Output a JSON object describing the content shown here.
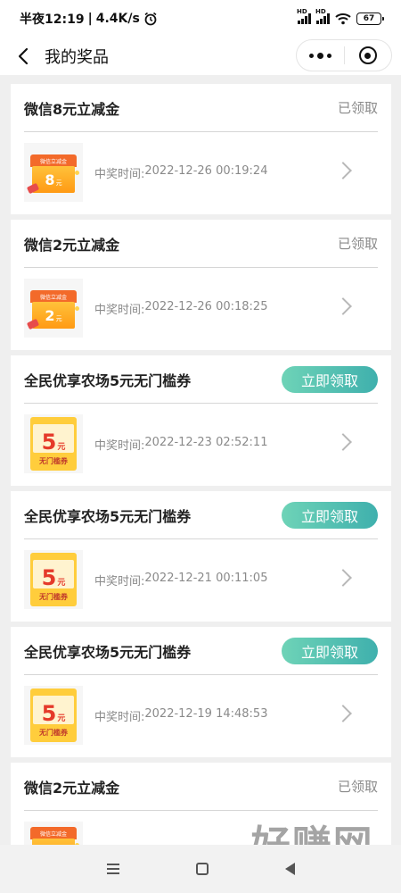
{
  "status_bar": {
    "time": "半夜12:19",
    "speed": "4.4K/s",
    "battery": "67"
  },
  "nav": {
    "title": "我的奖品"
  },
  "labels": {
    "win_time_prefix": "中奖时间:",
    "claimed": "已领取",
    "claim_now": "立即领取"
  },
  "prizes": [
    {
      "title": "微信8元立减金",
      "status": "已领取",
      "time": "2022-12-26 00:19:24",
      "thumb_value": "8",
      "thumb_unit": "元",
      "thumb_label": "微信立减金"
    },
    {
      "title": "微信2元立减金",
      "status": "已领取",
      "time": "2022-12-26 00:18:25",
      "thumb_value": "2",
      "thumb_unit": "元",
      "thumb_label": "微信立减金"
    },
    {
      "title": "全民优享农场5元无门槛券",
      "status": "立即领取",
      "time": "2022-12-23 02:52:11",
      "thumb_value": "5",
      "thumb_unit": "元",
      "thumb_label": "无门槛券"
    },
    {
      "title": "全民优享农场5元无门槛券",
      "status": "立即领取",
      "time": "2022-12-21 00:11:05",
      "thumb_value": "5",
      "thumb_unit": "元",
      "thumb_label": "无门槛券"
    },
    {
      "title": "全民优享农场5元无门槛券",
      "status": "立即领取",
      "time": "2022-12-19 14:48:53",
      "thumb_value": "5",
      "thumb_unit": "元",
      "thumb_label": "无门槛券"
    },
    {
      "title": "微信2元立减金",
      "status": "已领取",
      "time": "",
      "thumb_value": "",
      "thumb_unit": "",
      "thumb_label": "微信立减金"
    }
  ],
  "watermark": {
    "text": "好赚网",
    "url": "www.zhuanyes.com"
  },
  "colors": {
    "claim_button_start": "#6ed3b7",
    "claim_button_end": "#3fb0ad",
    "claimed_text": "#8a8a8a"
  }
}
